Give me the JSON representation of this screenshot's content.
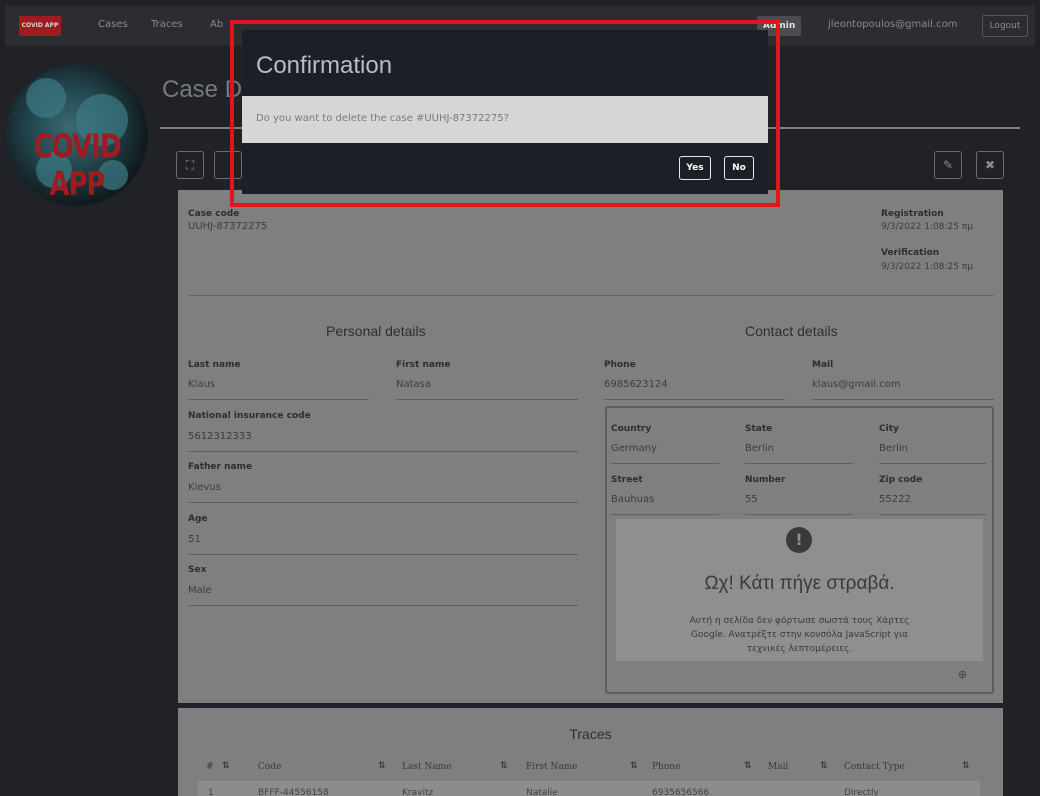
{
  "navbar": {
    "brand": "COVID APP",
    "links": [
      "Cases",
      "Traces",
      "Ab"
    ],
    "user_badge": "Admin",
    "email": "jleontopoulos@gmail.com",
    "logout": "Logout"
  },
  "logo": {
    "text": "COVID APP"
  },
  "page": {
    "title": "Case D"
  },
  "toolbar": {
    "expand_icon": "expand-icon",
    "edit_icon": "pencil-icon",
    "close_icon": "close-icon",
    "expand_glyph": "⛶",
    "edit_glyph": "✎",
    "close_glyph": "✖"
  },
  "case": {
    "code_label": "Case code",
    "code_value": "UUHJ-87372275",
    "registration_label": "Registration",
    "registration_value": "9/3/2022 1:08:25 πμ",
    "verification_label": "Verification",
    "verification_value": "9/3/2022 1:08:25 πμ"
  },
  "personal": {
    "heading": "Personal details",
    "last_name_label": "Last name",
    "last_name": "Klaus",
    "first_name_label": "First name",
    "first_name": "Natasa",
    "insurance_label": "National insurance code",
    "insurance": "5612312333",
    "father_label": "Father name",
    "father": "Kievus",
    "age_label": "Age",
    "age": "51",
    "sex_label": "Sex",
    "sex": "Male"
  },
  "contact": {
    "heading": "Contact details",
    "phone_label": "Phone",
    "phone": "6985623124",
    "mail_label": "Mail",
    "mail": "klaus@gmail.com",
    "country_label": "Country",
    "country": "Germany",
    "state_label": "State",
    "state": "Berlin",
    "city_label": "City",
    "city": "Berlin",
    "street_label": "Street",
    "street": "Bauhuas",
    "number_label": "Number",
    "number": "55",
    "zip_label": "Zip code",
    "zip": "55222"
  },
  "map_error": {
    "icon": "!",
    "title": "Ωχ! Κάτι πήγε στραβά.",
    "body": "Αυτή η σελίδα δεν φόρτωσε σωστά τους Χάρτες Google. Ανατρέξτε στην κονσόλα JavaScript για τεχνικές λεπτομέρειες."
  },
  "traces": {
    "title": "Traces",
    "columns": [
      "#",
      "Code",
      "Last Name",
      "First Name",
      "Phone",
      "Mail",
      "Contact Type"
    ],
    "sort_glyph": "⇅",
    "row": [
      "1",
      "BFFF-44556158",
      "Kravitz",
      "Natalie",
      "6935656566",
      "",
      "Directly"
    ]
  },
  "modal": {
    "title": "Confirmation",
    "message": "Do you want to delete the case #UUHJ-87372275?",
    "yes": "Yes",
    "no": "No"
  },
  "colors": {
    "highlight": "#e0161c",
    "brand": "#9e1b20",
    "modal_bg": "#1c1f26"
  }
}
